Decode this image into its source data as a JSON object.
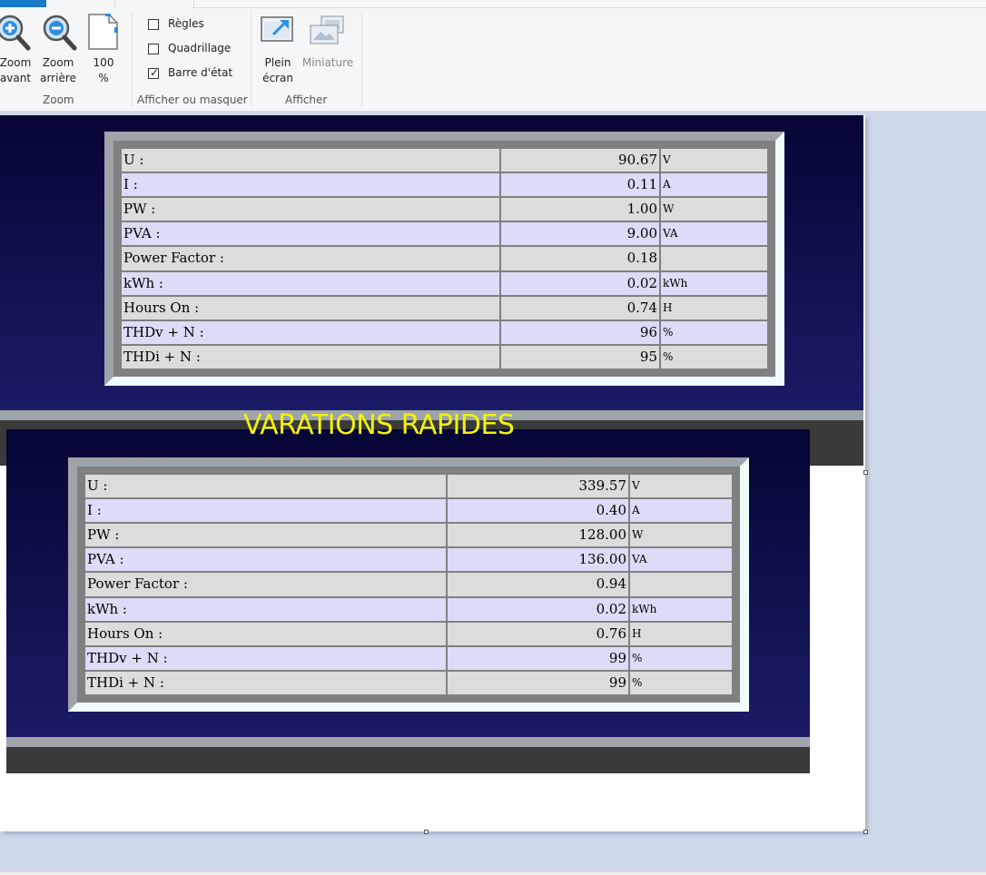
{
  "ribbon": {
    "groups": {
      "zoom": {
        "label": "Zoom",
        "buttons": [
          {
            "label": "Zoom\navant",
            "icon": "zoom-in-icon"
          },
          {
            "label": "Zoom\narrière",
            "icon": "zoom-out-icon"
          },
          {
            "label": "100\n%",
            "icon": "actual-size-page-icon"
          }
        ]
      },
      "show_hide": {
        "label": "Afficher ou masquer",
        "options": [
          {
            "label": "Règles",
            "checked": false
          },
          {
            "label": "Quadrillage",
            "checked": false
          },
          {
            "label": "Barre d'état",
            "checked": true
          }
        ]
      },
      "display": {
        "label": "Afficher",
        "buttons": [
          {
            "label": "Plein\nécran",
            "icon": "full-screen-icon",
            "enabled": true
          },
          {
            "label": "Miniature",
            "icon": "thumbnail-icon",
            "enabled": false
          }
        ]
      }
    }
  },
  "content": {
    "section_title": "VARATIONS RAPIDES",
    "table_top": {
      "rows": [
        {
          "label": "U :",
          "value": "90.67",
          "unit": "V"
        },
        {
          "label": "I :",
          "value": "0.11",
          "unit": "A"
        },
        {
          "label": "PW :",
          "value": "1.00",
          "unit": "W"
        },
        {
          "label": "PVA :",
          "value": "9.00",
          "unit": "VA"
        },
        {
          "label": "Power Factor :",
          "value": "0.18",
          "unit": ""
        },
        {
          "label": "kWh :",
          "value": "0.02",
          "unit": "kWh"
        },
        {
          "label": "Hours On :",
          "value": "0.74",
          "unit": "H"
        },
        {
          "label": "THDv + N :",
          "value": "96",
          "unit": "%"
        },
        {
          "label": "THDi + N :",
          "value": "95",
          "unit": "%"
        }
      ]
    },
    "table_bottom": {
      "rows": [
        {
          "label": "U :",
          "value": "339.57",
          "unit": "V"
        },
        {
          "label": "I :",
          "value": "0.40",
          "unit": "A"
        },
        {
          "label": "PW :",
          "value": "128.00",
          "unit": "W"
        },
        {
          "label": "PVA :",
          "value": "136.00",
          "unit": "VA"
        },
        {
          "label": "Power Factor :",
          "value": "0.94",
          "unit": ""
        },
        {
          "label": "kWh :",
          "value": "0.02",
          "unit": "kWh"
        },
        {
          "label": "Hours On :",
          "value": "0.76",
          "unit": "H"
        },
        {
          "label": "THDv + N :",
          "value": "99",
          "unit": "%"
        },
        {
          "label": "THDi + N :",
          "value": "99",
          "unit": "%"
        }
      ]
    }
  },
  "colors": {
    "panel_dark": "#050535",
    "panel_light": "#1b1b66",
    "row_odd": "#dcdcdc",
    "row_even": "#dcdcf8",
    "title_yellow": "#f2f20e",
    "accent": "#1979ca"
  }
}
